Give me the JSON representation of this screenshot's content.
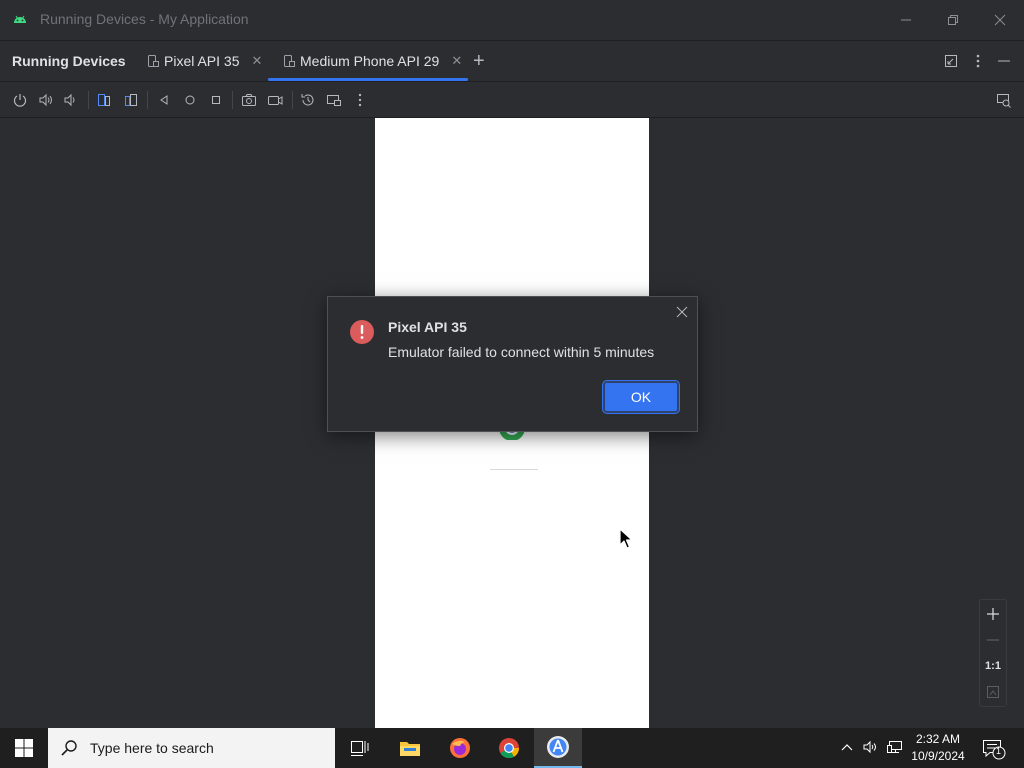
{
  "window": {
    "title": "Running Devices - My Application"
  },
  "tool_window": {
    "title": "Running Devices",
    "tabs": [
      {
        "label": "Pixel API 35",
        "active": false
      },
      {
        "label": "Medium Phone API 29",
        "active": true
      }
    ],
    "add_tab_symbol": "+"
  },
  "toolbar": {
    "icons": [
      "power-icon",
      "volume-up-icon",
      "volume-down-icon",
      "rotate-left-icon",
      "rotate-right-icon",
      "back-icon",
      "home-icon",
      "overview-icon",
      "screenshot-icon",
      "screen-record-icon",
      "snapshot-icon",
      "device-frame-icon",
      "more-icon",
      "mirror-icon"
    ]
  },
  "dialog": {
    "title": "Pixel API 35",
    "message": "Emulator failed to connect within 5 minutes",
    "ok_label": "OK",
    "icon": "error-icon"
  },
  "zoom": {
    "one_to_one_label": "1:1"
  },
  "taskbar": {
    "search_placeholder": "Type here to search",
    "apps": [
      "task-view-icon",
      "file-explorer-icon",
      "firefox-icon",
      "chrome-icon",
      "android-studio-icon"
    ],
    "time": "2:32 AM",
    "date": "10/9/2024",
    "notification_count": "1"
  },
  "colors": {
    "accent": "#3574f0",
    "error": "#db5c5c",
    "ide_background": "#2b2d30"
  }
}
